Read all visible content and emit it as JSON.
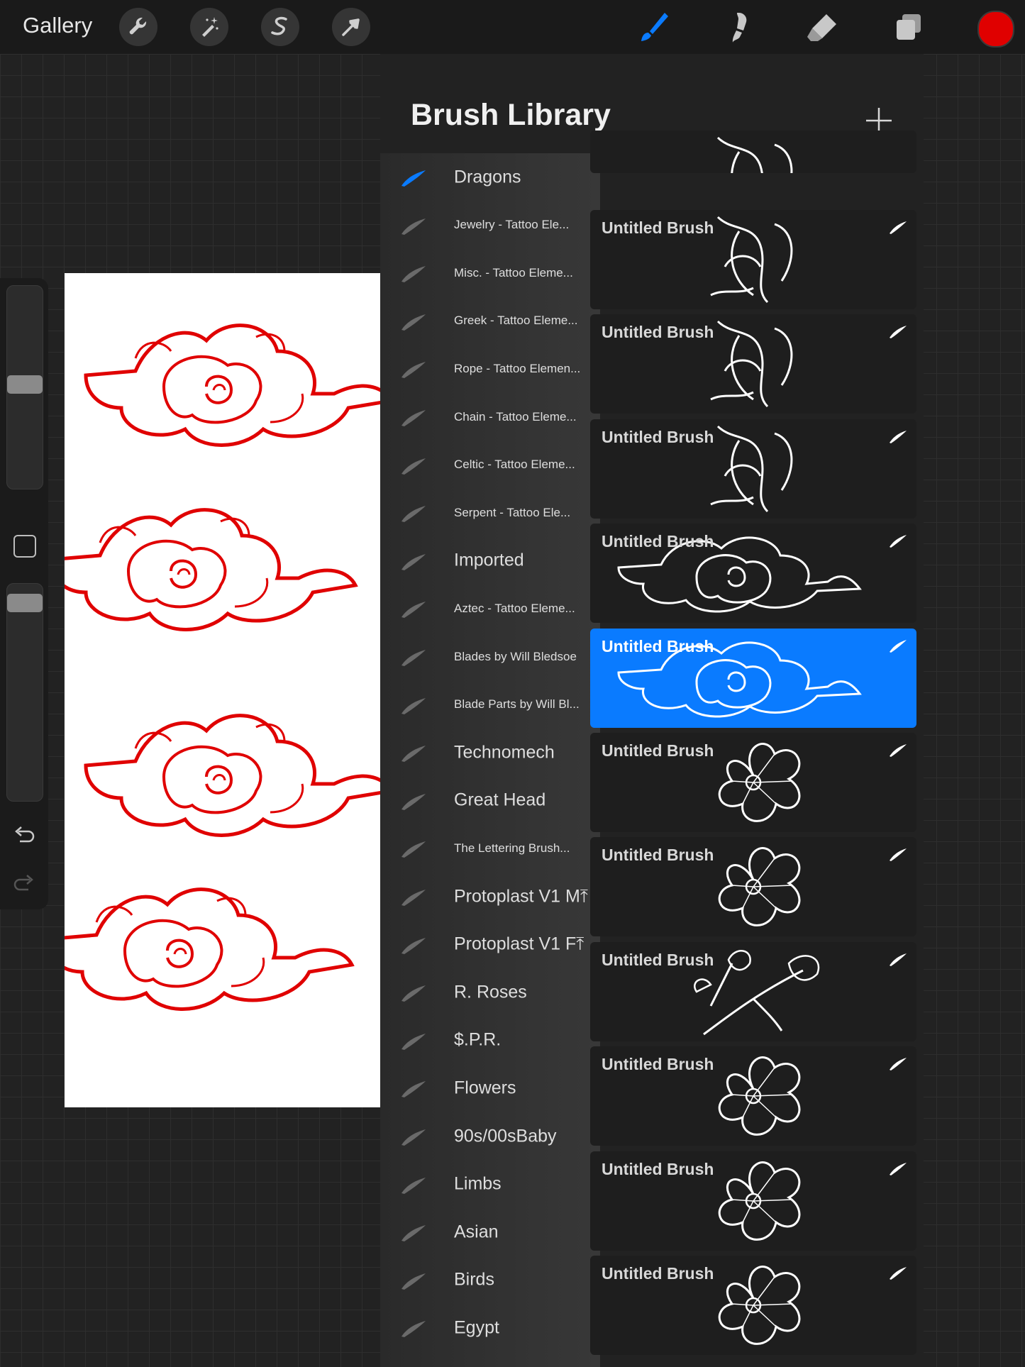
{
  "topbar": {
    "gallery_label": "Gallery",
    "tools_left": [
      "wrench-icon",
      "magic-wand-icon",
      "selection-s-icon",
      "transform-arrow-icon"
    ],
    "tools_right": [
      "brush-icon",
      "smudge-icon",
      "eraser-icon",
      "layers-icon"
    ],
    "active_color": "#e00000",
    "active_tool_color": "#0a7bff"
  },
  "panel": {
    "title": "Brush Library",
    "add_label": "+"
  },
  "brush_sets": [
    {
      "label": "Dragons",
      "size": "big",
      "active": true
    },
    {
      "label": "Jewelry - Tattoo Ele...",
      "size": "small"
    },
    {
      "label": "Misc. - Tattoo Eleme...",
      "size": "small"
    },
    {
      "label": "Greek - Tattoo Eleme...",
      "size": "small"
    },
    {
      "label": "Rope - Tattoo Elemen...",
      "size": "small"
    },
    {
      "label": "Chain - Tattoo Eleme...",
      "size": "small"
    },
    {
      "label": "Celtic - Tattoo Eleme...",
      "size": "small"
    },
    {
      "label": "Serpent - Tattoo Ele...",
      "size": "small"
    },
    {
      "label": "Imported",
      "size": "big"
    },
    {
      "label": "Aztec - Tattoo Eleme...",
      "size": "small"
    },
    {
      "label": "Blades by Will Bledsoe",
      "size": "small"
    },
    {
      "label": "Blade Parts by Will Bl...",
      "size": "small"
    },
    {
      "label": "Technomech",
      "size": "big"
    },
    {
      "label": "Great Head",
      "size": "big"
    },
    {
      "label": "The Lettering Brush...",
      "size": "small"
    },
    {
      "label": "Protoplast V1 M⤒",
      "size": "big"
    },
    {
      "label": "Protoplast V1 F⤒",
      "size": "big"
    },
    {
      "label": "R. Roses",
      "size": "big"
    },
    {
      "label": "$.P.R.",
      "size": "big"
    },
    {
      "label": "Flowers",
      "size": "big"
    },
    {
      "label": "90s/00sBaby",
      "size": "big"
    },
    {
      "label": "Limbs",
      "size": "big"
    },
    {
      "label": "Asian",
      "size": "big"
    },
    {
      "label": "Birds",
      "size": "big"
    },
    {
      "label": "Egypt",
      "size": "big"
    }
  ],
  "brushes": [
    {
      "name": "",
      "preview": "dragon-claw"
    },
    {
      "name": "Untitled Brush",
      "preview": "dragon-claw"
    },
    {
      "name": "Untitled Brush",
      "preview": "dragon-claw"
    },
    {
      "name": "Untitled Brush",
      "preview": "dragon-claw"
    },
    {
      "name": "Untitled Brush",
      "preview": "cloud"
    },
    {
      "name": "Untitled Brush",
      "preview": "cloud",
      "selected": true
    },
    {
      "name": "Untitled Brush",
      "preview": "flower"
    },
    {
      "name": "Untitled Brush",
      "preview": "flower"
    },
    {
      "name": "Untitled Brush",
      "preview": "blossom-branch"
    },
    {
      "name": "Untitled Brush",
      "preview": "flower"
    },
    {
      "name": "Untitled Brush",
      "preview": "flower"
    },
    {
      "name": "Untitled Brush",
      "preview": "flower"
    }
  ],
  "canvas": {
    "stroke_color": "#e00000"
  }
}
